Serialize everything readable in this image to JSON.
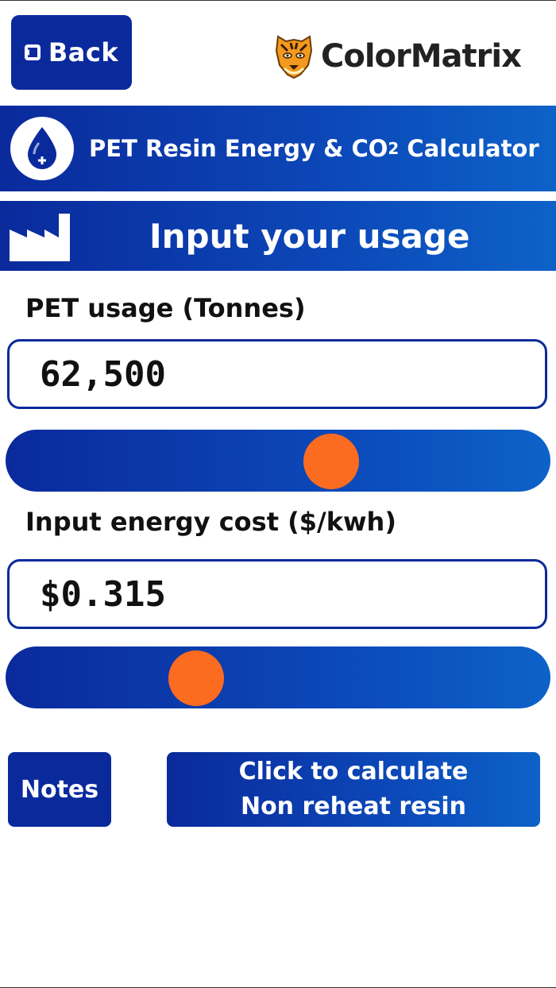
{
  "header": {
    "back_label": "Back",
    "brand_name": "ColorMatrix"
  },
  "title_band": {
    "title_prefix": "PET Resin Energy & CO",
    "title_subscript": "2",
    "title_suffix": " Calculator"
  },
  "section_band": {
    "title": "Input your usage"
  },
  "pet_usage": {
    "label": "PET usage (Tonnes)",
    "value": "62,500",
    "slider_position": 0.61
  },
  "energy_cost": {
    "label": "Input energy cost ($/kwh)",
    "value": "$0.315",
    "slider_position": 0.33
  },
  "actions": {
    "notes_label": "Notes",
    "calculate_line1": "Click to calculate",
    "calculate_line2": "Non reheat resin"
  },
  "colors": {
    "primary_blue": "#0a2a9c",
    "accent_orange": "#fb6b20"
  },
  "icons": [
    "back-icon",
    "tiger-logo-icon",
    "water-drop-plus-icon",
    "factory-icon"
  ]
}
